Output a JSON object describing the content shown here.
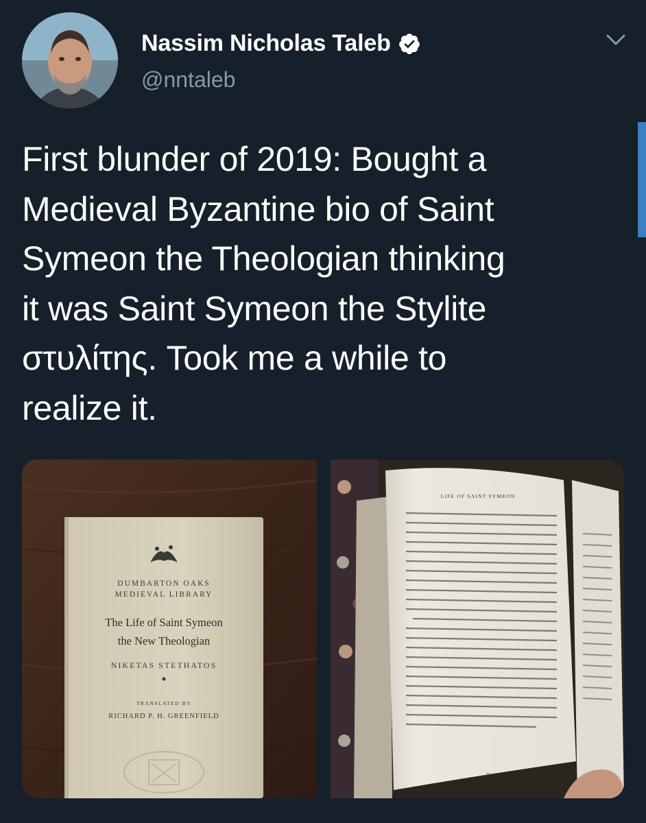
{
  "tweet": {
    "author": {
      "display_name": "Nassim Nicholas Taleb",
      "handle": "@nntaleb",
      "verified": true,
      "avatar_icon": "profile-photo"
    },
    "menu_icon": "chevron-down-icon",
    "text_lines": [
      "First blunder of 2019: Bought a",
      "Medieval Byzantine bio of Saint",
      "Symeon the Theologian thinking",
      "it was Saint Symeon the Stylite",
      "στυλίτης. Took me a while to",
      "realize it."
    ]
  },
  "media": {
    "book_cover": {
      "series_line1": "DUMBARTON OAKS",
      "series_line2": "MEDIEVAL LIBRARY",
      "title_line1": "The Life of Saint Symeon",
      "title_line2": "the New Theologian",
      "author": "NIKETAS STETHATOS",
      "translated_by": "TRANSLATED BY",
      "translator": "RICHARD P. H. GREENFIELD"
    },
    "open_page": {
      "running_head": "LIFE OF SAINT SYMEON",
      "page_number": "73"
    }
  },
  "colors": {
    "background": "#15202b",
    "handle": "#8899a6",
    "verified": "#ffffff",
    "accent": "#3b7fc4"
  }
}
